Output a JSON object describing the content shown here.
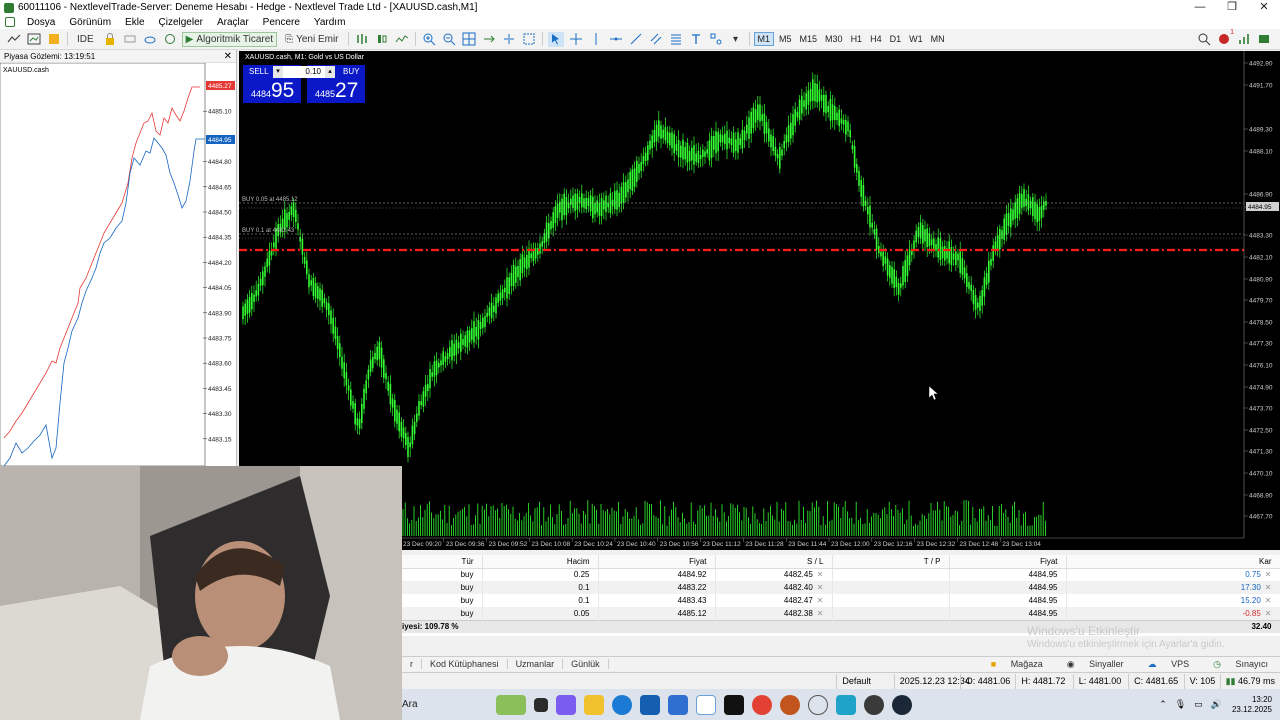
{
  "window": {
    "title": "60011106 - NextlevelTrade-Server: Deneme Hesabı - Hedge - Nextlevel Trade Ltd - [XAUUSD.cash,M1]",
    "controls": [
      "—",
      "❐",
      "✕"
    ]
  },
  "menu": {
    "items": [
      "Dosya",
      "Görünüm",
      "Ekle",
      "Çizelgeler",
      "Araçlar",
      "Pencere",
      "Yardım"
    ]
  },
  "toolbar": {
    "ide_label": "IDE",
    "algo_label": "Algoritmik Ticaret",
    "new_order_label": "Yeni Emir",
    "timeframes": [
      "M1",
      "M5",
      "M15",
      "M30",
      "H1",
      "H4",
      "D1",
      "W1",
      "MN"
    ],
    "active_timeframe": "M1",
    "badge_count": "1"
  },
  "market_watch": {
    "header": "Piyasa Gözlemi: 13:19:51",
    "symbol": "XAUUSD.cash",
    "price_ticks": [
      "4485.27",
      "4485.10",
      "4484.95",
      "4484.80",
      "4484.65",
      "4484.50",
      "4484.35",
      "4484.20",
      "4484.05",
      "4483.90",
      "4483.75",
      "4483.60",
      "4483.45",
      "4483.30",
      "4483.15"
    ],
    "ask_label": "4485.27",
    "bid_label": "4484.95"
  },
  "chart": {
    "title": "XAUUSD.cash, M1:  Gold vs US Dollar",
    "sell": {
      "label": "SELL",
      "small": "4484",
      "big": "95"
    },
    "buy": {
      "label": "BUY",
      "small": "4485",
      "big": "27"
    },
    "lot": "0.10",
    "price_ticks": [
      "4492.90",
      "4491.70",
      "4489.30",
      "4488.10",
      "4486.90",
      "4485.70",
      "4484.95",
      "4483.30",
      "4482.10",
      "4480.90",
      "4479.70",
      "4478.50",
      "4477.30",
      "4476.10",
      "4474.90",
      "4473.70",
      "4472.50",
      "4471.30",
      "4470.10",
      "4468.90",
      "4467.70"
    ],
    "time_ticks": [
      "23 Dec 09:20",
      "23 Dec 09:36",
      "23 Dec 09:52",
      "23 Dec 10:08",
      "23 Dec 10:24",
      "23 Dec 10:40",
      "23 Dec 10:56",
      "23 Dec 11:12",
      "23 Dec 11:28",
      "23 Dec 11:44",
      "23 Dec 12:00",
      "23 Dec 12:16",
      "23 Dec 12:32",
      "23 Dec 12:48",
      "23 Dec 13:04"
    ],
    "lines": {
      "buy_line_1": "BUY 0.05 at 4485.12",
      "buy_line_2": "BUY 0.1 at 4483.43"
    }
  },
  "trade": {
    "columns": [
      "Tür",
      "Hacim",
      "Fiyat",
      "S / L",
      "T / P",
      "Fiyat",
      "Kar"
    ],
    "rows": [
      {
        "type": "buy",
        "volume": "0.25",
        "price": "4484.92",
        "sl": "4482.45",
        "tp": "",
        "cur": "4484.95",
        "profit": "0.75",
        "neg": false
      },
      {
        "type": "buy",
        "volume": "0.1",
        "price": "4483.22",
        "sl": "4482.40",
        "tp": "",
        "cur": "4484.95",
        "profit": "17.30",
        "neg": false
      },
      {
        "type": "buy",
        "volume": "0.1",
        "price": "4483.43",
        "sl": "4482.47",
        "tp": "",
        "cur": "4484.95",
        "profit": "15.20",
        "neg": false
      },
      {
        "type": "buy",
        "volume": "0.05",
        "price": "4485.12",
        "sl": "4482.38",
        "tp": "",
        "cur": "4484.95",
        "profit": "-0.85",
        "neg": true
      }
    ],
    "total_label": "iyesi: 109.78 %",
    "total_profit": "32.40"
  },
  "watermark": {
    "line1": "Windows'u Etkinleştir",
    "line2": "Windows'u etkinleştirmek için Ayarlar'a gidin."
  },
  "tabs": {
    "items": [
      "r",
      "Kod Kütüphanesi",
      "Uzmanlar",
      "Günlük"
    ],
    "right": [
      "Mağaza",
      "Sinyaller",
      "VPS",
      "Sınayıcı"
    ]
  },
  "status": {
    "profile": "Default",
    "time": "2025.12.23 12:34",
    "open": "O: 4481.06",
    "high": "H: 4481.72",
    "low": "L: 4481.00",
    "close": "C: 4481.65",
    "volume": "V: 105",
    "ping": "46.79 ms"
  },
  "taskbar": {
    "search": "Ara",
    "time": "13:20",
    "date": "23.12.2025"
  },
  "colors": {
    "chart_bg": "#000000",
    "candle": "#32ff32",
    "order_button": "#0b18c7",
    "stop_line": "#ff1a1a",
    "loss": "#d32f2f",
    "profit": "#1565c0"
  }
}
